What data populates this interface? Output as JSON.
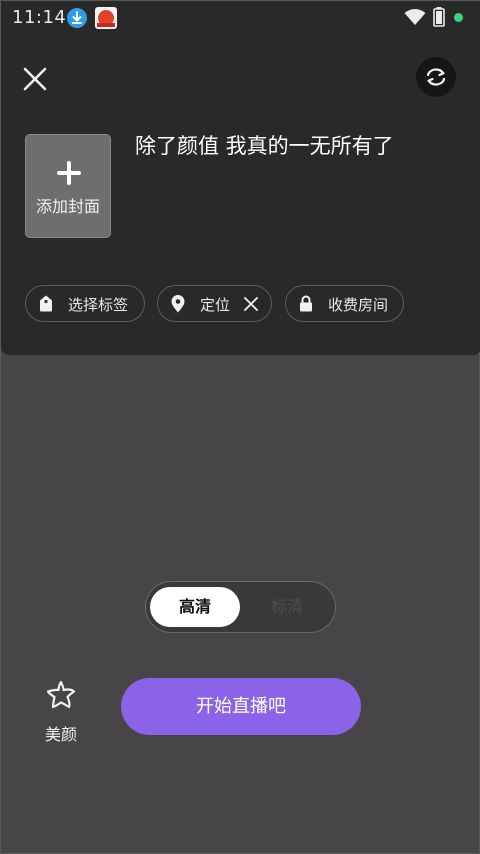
{
  "status_bar": {
    "time": "11:14",
    "icons": [
      "download-icon",
      "app-icon",
      "wifi-icon",
      "battery-icon",
      "notification-dot"
    ]
  },
  "top_panel": {
    "close_icon": "close-icon",
    "flip_icon": "camera-flip-icon",
    "cover": {
      "label": "添加封面",
      "icon": "plus-icon"
    },
    "title": "除了颜值 我真的一无所有了",
    "chips": {
      "tags": {
        "label": "选择标签",
        "icon": "tag-icon"
      },
      "location": {
        "label": "定位",
        "icon": "location-pin-icon",
        "remove_icon": "close-icon"
      },
      "paid_room": {
        "label": "收费房间",
        "icon": "lock-icon"
      }
    }
  },
  "quality_toggle": {
    "selected": "高清",
    "other": "标清"
  },
  "beauty": {
    "label": "美颜",
    "icon": "beauty-star-icon"
  },
  "start_button": {
    "label": "开始直播吧"
  },
  "colors": {
    "background": "#474547",
    "panel": "#292929",
    "accent": "#8a63e8",
    "status_dot": "#3fd47c"
  }
}
